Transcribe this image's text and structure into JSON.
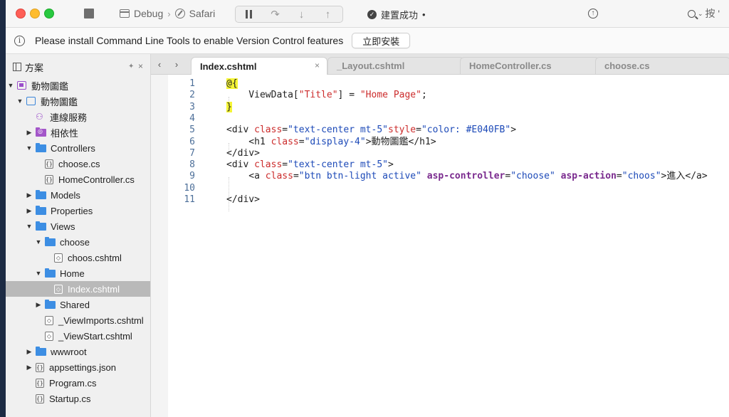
{
  "toolbar": {
    "config": "Debug",
    "separator": "›",
    "browser": "Safari",
    "status": "建置成功",
    "status_dot": "•",
    "search_text": "按 '"
  },
  "infobar": {
    "message": "Please install Command Line Tools to enable Version Control features",
    "button": "立即安裝"
  },
  "sidebar": {
    "title": "方案",
    "pin": "✦",
    "close": "×",
    "items": [
      {
        "label": "動物圖鑑",
        "kind": "solution",
        "depth": 0,
        "expanded": true
      },
      {
        "label": "動物圖鑑",
        "kind": "project",
        "depth": 1,
        "expanded": true
      },
      {
        "label": "連線服務",
        "kind": "service",
        "depth": 2
      },
      {
        "label": "相依性",
        "kind": "deps-folder",
        "depth": 2,
        "expanded": false
      },
      {
        "label": "Controllers",
        "kind": "folder",
        "depth": 2,
        "expanded": true
      },
      {
        "label": "choose.cs",
        "kind": "cs-file",
        "depth": 3
      },
      {
        "label": "HomeController.cs",
        "kind": "cs-file",
        "depth": 3
      },
      {
        "label": "Models",
        "kind": "folder",
        "depth": 2,
        "expanded": false
      },
      {
        "label": "Properties",
        "kind": "folder",
        "depth": 2,
        "expanded": false
      },
      {
        "label": "Views",
        "kind": "folder",
        "depth": 2,
        "expanded": true
      },
      {
        "label": "choose",
        "kind": "folder",
        "depth": 3,
        "expanded": true
      },
      {
        "label": "choos.cshtml",
        "kind": "html-file",
        "depth": 4
      },
      {
        "label": "Home",
        "kind": "folder",
        "depth": 3,
        "expanded": true
      },
      {
        "label": "Index.cshtml",
        "kind": "html-file",
        "depth": 4,
        "selected": true
      },
      {
        "label": "Shared",
        "kind": "folder",
        "depth": 3,
        "expanded": false
      },
      {
        "label": "_ViewImports.cshtml",
        "kind": "html-file",
        "depth": 3
      },
      {
        "label": "_ViewStart.cshtml",
        "kind": "html-file",
        "depth": 3
      },
      {
        "label": "wwwroot",
        "kind": "folder",
        "depth": 2,
        "expanded": false
      },
      {
        "label": "appsettings.json",
        "kind": "json-file",
        "depth": 2,
        "expanded": false
      },
      {
        "label": "Program.cs",
        "kind": "cs-file",
        "depth": 2
      },
      {
        "label": "Startup.cs",
        "kind": "cs-file",
        "depth": 2
      }
    ]
  },
  "tabs": [
    {
      "label": "Index.cshtml",
      "active": true
    },
    {
      "label": "_Layout.cshtml",
      "active": false
    },
    {
      "label": "HomeController.cs",
      "active": false
    },
    {
      "label": "choose.cs",
      "active": false
    }
  ],
  "tab_close": "×",
  "editor": {
    "lines": [
      {
        "n": "1",
        "segs": [
          {
            "t": "@{",
            "c": "razor"
          }
        ]
      },
      {
        "n": "2",
        "segs": [
          {
            "t": "    ViewData[",
            "c": "tag"
          },
          {
            "t": "\"Title\"",
            "c": "attr"
          },
          {
            "t": "] = ",
            "c": "tag"
          },
          {
            "t": "\"Home Page\"",
            "c": "attr"
          },
          {
            "t": ";",
            "c": "tag"
          }
        ]
      },
      {
        "n": "3",
        "segs": [
          {
            "t": "}",
            "c": "razor"
          }
        ]
      },
      {
        "n": "4",
        "segs": []
      },
      {
        "n": "5",
        "segs": [
          {
            "t": "<div ",
            "c": "tag"
          },
          {
            "t": "class",
            "c": "attr"
          },
          {
            "t": "=",
            "c": "tag"
          },
          {
            "t": "\"text-center mt-5\"",
            "c": "val"
          },
          {
            "t": "style",
            "c": "attr"
          },
          {
            "t": "=",
            "c": "tag"
          },
          {
            "t": "\"color: ",
            "c": "val"
          },
          {
            "t": "#E040FB",
            "c": "val"
          },
          {
            "t": "\"",
            "c": "val"
          },
          {
            "t": ">",
            "c": "tag"
          }
        ]
      },
      {
        "n": "6",
        "segs": [
          {
            "t": "    <h1 ",
            "c": "tag"
          },
          {
            "t": "class",
            "c": "attr"
          },
          {
            "t": "=",
            "c": "tag"
          },
          {
            "t": "\"display-4\"",
            "c": "val"
          },
          {
            "t": ">動物圖鑑</h1>",
            "c": "tag"
          }
        ]
      },
      {
        "n": "7",
        "segs": [
          {
            "t": "</div>",
            "c": "tag"
          }
        ]
      },
      {
        "n": "8",
        "segs": [
          {
            "t": "<div ",
            "c": "tag"
          },
          {
            "t": "class",
            "c": "attr"
          },
          {
            "t": "=",
            "c": "tag"
          },
          {
            "t": "\"text-center mt-5\"",
            "c": "val"
          },
          {
            "t": ">",
            "c": "tag"
          }
        ]
      },
      {
        "n": "9",
        "segs": [
          {
            "t": "    <a ",
            "c": "tag"
          },
          {
            "t": "class",
            "c": "attr"
          },
          {
            "t": "=",
            "c": "tag"
          },
          {
            "t": "\"btn btn-light active\"",
            "c": "val"
          },
          {
            "t": " ",
            "c": "tag"
          },
          {
            "t": "asp-controller",
            "c": "aspattr"
          },
          {
            "t": "=",
            "c": "tag"
          },
          {
            "t": "\"choose\"",
            "c": "val"
          },
          {
            "t": " ",
            "c": "tag"
          },
          {
            "t": "asp-action",
            "c": "aspattr"
          },
          {
            "t": "=",
            "c": "tag"
          },
          {
            "t": "\"choos\"",
            "c": "val"
          },
          {
            "t": ">進入</a>",
            "c": "tag"
          }
        ]
      },
      {
        "n": "10",
        "segs": []
      },
      {
        "n": "11",
        "segs": [
          {
            "t": "</div>",
            "c": "tag"
          }
        ]
      }
    ]
  }
}
